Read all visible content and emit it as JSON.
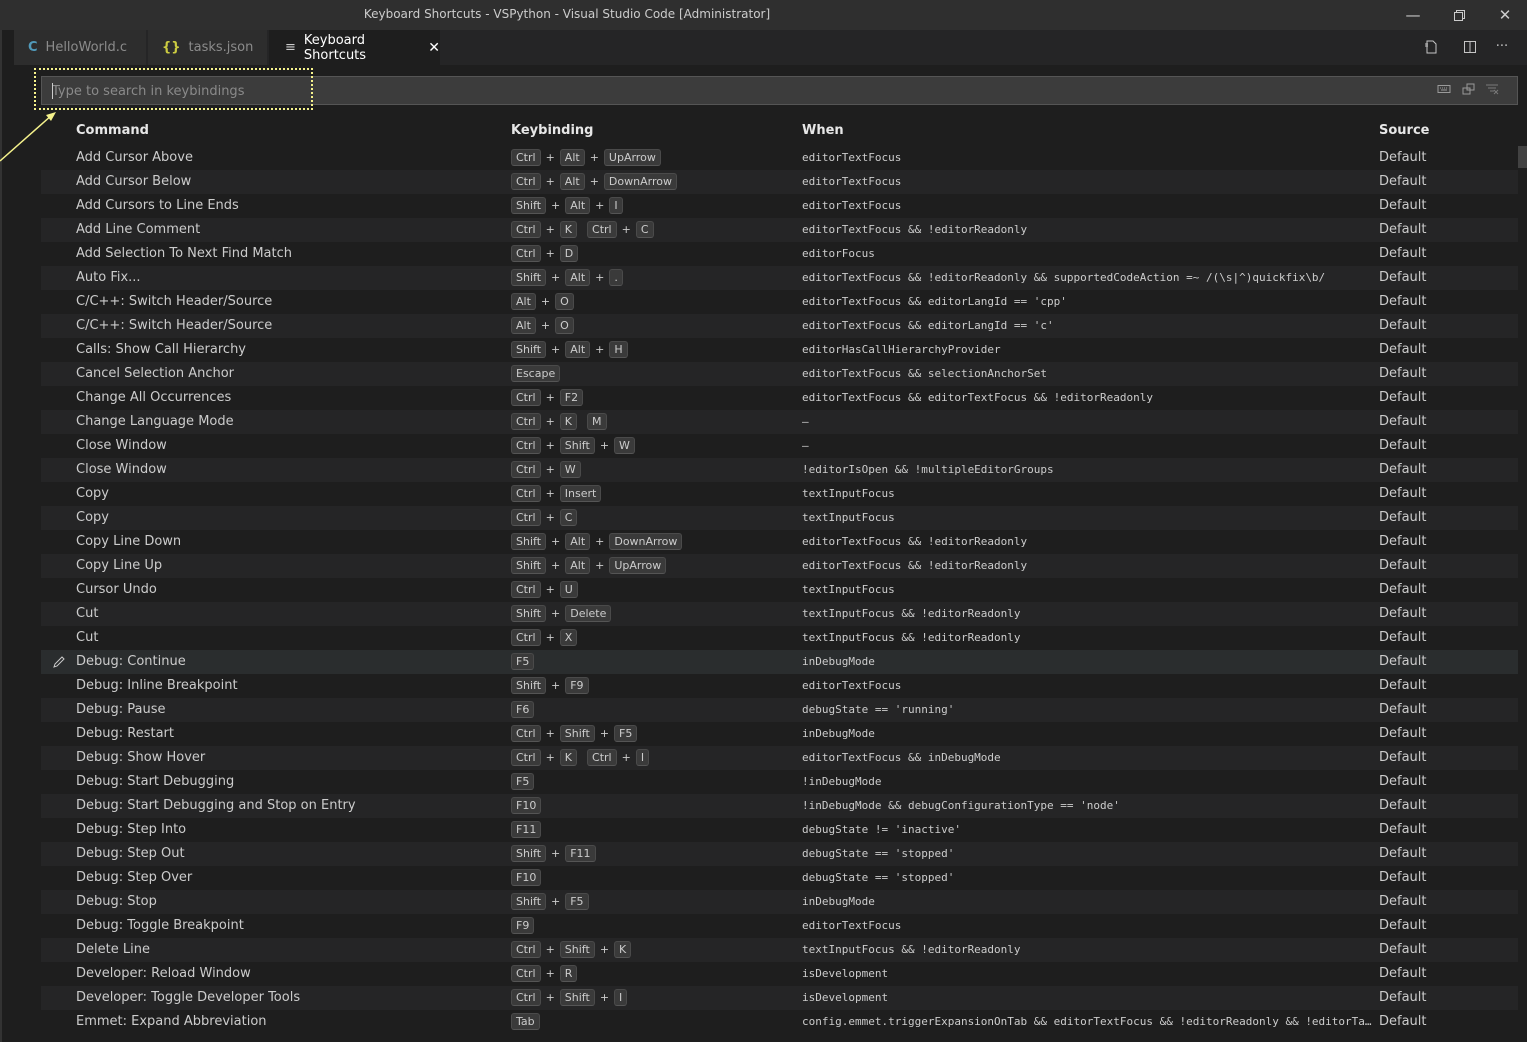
{
  "window": {
    "title": "Keyboard Shortcuts - VSPython - Visual Studio Code [Administrator]",
    "controls": [
      "minimize-icon",
      "restore-icon",
      "close-icon"
    ]
  },
  "tabs": [
    {
      "label": "HelloWorld.c",
      "icon": "C",
      "icon_color": "#519aba",
      "active": false
    },
    {
      "label": "tasks.json",
      "icon": "{}",
      "icon_color": "#cbcb41",
      "active": false
    },
    {
      "label": "Keyboard Shortcuts",
      "icon": "≡",
      "icon_color": "#cccccc",
      "active": true
    }
  ],
  "tab_actions": [
    "open-json-icon",
    "split-editor-icon",
    "more-actions-icon"
  ],
  "search": {
    "placeholder": "Type to search in keybindings",
    "value": "",
    "actions": [
      "record-keys-icon",
      "sort-by-precedence-icon",
      "clear-filter-icon"
    ]
  },
  "columns": {
    "command": "Command",
    "keybinding": "Keybinding",
    "when": "When",
    "source": "Source"
  },
  "rows": [
    {
      "command": "Add Cursor Above",
      "keys": [
        [
          "Ctrl",
          "Alt",
          "UpArrow"
        ]
      ],
      "when": "editorTextFocus",
      "source": "Default"
    },
    {
      "command": "Add Cursor Below",
      "keys": [
        [
          "Ctrl",
          "Alt",
          "DownArrow"
        ]
      ],
      "when": "editorTextFocus",
      "source": "Default"
    },
    {
      "command": "Add Cursors to Line Ends",
      "keys": [
        [
          "Shift",
          "Alt",
          "I"
        ]
      ],
      "when": "editorTextFocus",
      "source": "Default"
    },
    {
      "command": "Add Line Comment",
      "keys": [
        [
          "Ctrl",
          "K"
        ],
        [
          "Ctrl",
          "C"
        ]
      ],
      "when": "editorTextFocus && !editorReadonly",
      "source": "Default"
    },
    {
      "command": "Add Selection To Next Find Match",
      "keys": [
        [
          "Ctrl",
          "D"
        ]
      ],
      "when": "editorFocus",
      "source": "Default"
    },
    {
      "command": "Auto Fix...",
      "keys": [
        [
          "Shift",
          "Alt",
          "."
        ]
      ],
      "when": "editorTextFocus && !editorReadonly && supportedCodeAction =~ /(\\s|^)quickfix\\b/",
      "source": "Default"
    },
    {
      "command": "C/C++: Switch Header/Source",
      "keys": [
        [
          "Alt",
          "O"
        ]
      ],
      "when": "editorTextFocus && editorLangId == 'cpp'",
      "source": "Default"
    },
    {
      "command": "C/C++: Switch Header/Source",
      "keys": [
        [
          "Alt",
          "O"
        ]
      ],
      "when": "editorTextFocus && editorLangId == 'c'",
      "source": "Default"
    },
    {
      "command": "Calls: Show Call Hierarchy",
      "keys": [
        [
          "Shift",
          "Alt",
          "H"
        ]
      ],
      "when": "editorHasCallHierarchyProvider",
      "source": "Default"
    },
    {
      "command": "Cancel Selection Anchor",
      "keys": [
        [
          "Escape"
        ]
      ],
      "when": "editorTextFocus && selectionAnchorSet",
      "source": "Default"
    },
    {
      "command": "Change All Occurrences",
      "keys": [
        [
          "Ctrl",
          "F2"
        ]
      ],
      "when": "editorTextFocus && editorTextFocus && !editorReadonly",
      "source": "Default"
    },
    {
      "command": "Change Language Mode",
      "keys": [
        [
          "Ctrl",
          "K"
        ],
        [
          "M"
        ]
      ],
      "when": "—",
      "source": "Default"
    },
    {
      "command": "Close Window",
      "keys": [
        [
          "Ctrl",
          "Shift",
          "W"
        ]
      ],
      "when": "—",
      "source": "Default"
    },
    {
      "command": "Close Window",
      "keys": [
        [
          "Ctrl",
          "W"
        ]
      ],
      "when": "!editorIsOpen && !multipleEditorGroups",
      "source": "Default"
    },
    {
      "command": "Copy",
      "keys": [
        [
          "Ctrl",
          "Insert"
        ]
      ],
      "when": "textInputFocus",
      "source": "Default"
    },
    {
      "command": "Copy",
      "keys": [
        [
          "Ctrl",
          "C"
        ]
      ],
      "when": "textInputFocus",
      "source": "Default"
    },
    {
      "command": "Copy Line Down",
      "keys": [
        [
          "Shift",
          "Alt",
          "DownArrow"
        ]
      ],
      "when": "editorTextFocus && !editorReadonly",
      "source": "Default"
    },
    {
      "command": "Copy Line Up",
      "keys": [
        [
          "Shift",
          "Alt",
          "UpArrow"
        ]
      ],
      "when": "editorTextFocus && !editorReadonly",
      "source": "Default"
    },
    {
      "command": "Cursor Undo",
      "keys": [
        [
          "Ctrl",
          "U"
        ]
      ],
      "when": "textInputFocus",
      "source": "Default"
    },
    {
      "command": "Cut",
      "keys": [
        [
          "Shift",
          "Delete"
        ]
      ],
      "when": "textInputFocus && !editorReadonly",
      "source": "Default"
    },
    {
      "command": "Cut",
      "keys": [
        [
          "Ctrl",
          "X"
        ]
      ],
      "when": "textInputFocus && !editorReadonly",
      "source": "Default"
    },
    {
      "command": "Debug: Continue",
      "keys": [
        [
          "F5"
        ]
      ],
      "when": "inDebugMode",
      "source": "Default",
      "focused": true
    },
    {
      "command": "Debug: Inline Breakpoint",
      "keys": [
        [
          "Shift",
          "F9"
        ]
      ],
      "when": "editorTextFocus",
      "source": "Default"
    },
    {
      "command": "Debug: Pause",
      "keys": [
        [
          "F6"
        ]
      ],
      "when": "debugState == 'running'",
      "source": "Default"
    },
    {
      "command": "Debug: Restart",
      "keys": [
        [
          "Ctrl",
          "Shift",
          "F5"
        ]
      ],
      "when": "inDebugMode",
      "source": "Default"
    },
    {
      "command": "Debug: Show Hover",
      "keys": [
        [
          "Ctrl",
          "K"
        ],
        [
          "Ctrl",
          "I"
        ]
      ],
      "when": "editorTextFocus && inDebugMode",
      "source": "Default"
    },
    {
      "command": "Debug: Start Debugging",
      "keys": [
        [
          "F5"
        ]
      ],
      "when": "!inDebugMode",
      "source": "Default"
    },
    {
      "command": "Debug: Start Debugging and Stop on Entry",
      "keys": [
        [
          "F10"
        ]
      ],
      "when": "!inDebugMode && debugConfigurationType == 'node'",
      "source": "Default"
    },
    {
      "command": "Debug: Step Into",
      "keys": [
        [
          "F11"
        ]
      ],
      "when": "debugState != 'inactive'",
      "source": "Default"
    },
    {
      "command": "Debug: Step Out",
      "keys": [
        [
          "Shift",
          "F11"
        ]
      ],
      "when": "debugState == 'stopped'",
      "source": "Default"
    },
    {
      "command": "Debug: Step Over",
      "keys": [
        [
          "F10"
        ]
      ],
      "when": "debugState == 'stopped'",
      "source": "Default"
    },
    {
      "command": "Debug: Stop",
      "keys": [
        [
          "Shift",
          "F5"
        ]
      ],
      "when": "inDebugMode",
      "source": "Default"
    },
    {
      "command": "Debug: Toggle Breakpoint",
      "keys": [
        [
          "F9"
        ]
      ],
      "when": "editorTextFocus",
      "source": "Default"
    },
    {
      "command": "Delete Line",
      "keys": [
        [
          "Ctrl",
          "Shift",
          "K"
        ]
      ],
      "when": "textInputFocus && !editorReadonly",
      "source": "Default"
    },
    {
      "command": "Developer: Reload Window",
      "keys": [
        [
          "Ctrl",
          "R"
        ]
      ],
      "when": "isDevelopment",
      "source": "Default"
    },
    {
      "command": "Developer: Toggle Developer Tools",
      "keys": [
        [
          "Ctrl",
          "Shift",
          "I"
        ]
      ],
      "when": "isDevelopment",
      "source": "Default"
    },
    {
      "command": "Emmet: Expand Abbreviation",
      "keys": [
        [
          "Tab"
        ]
      ],
      "when": "config.emmet.triggerExpansionOnTab && editorTextFocus && !editorReadonly && !editorTabMovesFocus",
      "source": "Default"
    }
  ],
  "colors": {
    "background": "#1e1e1e",
    "titlebar": "#2f2f2f",
    "highlight_border": "#f5f28c"
  }
}
